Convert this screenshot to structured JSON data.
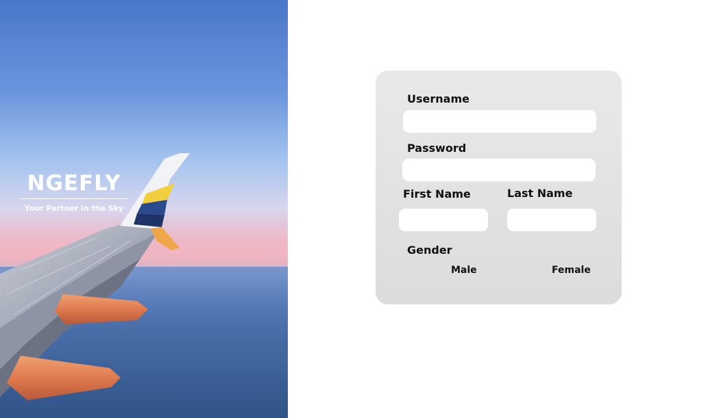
{
  "brand": {
    "name": "NGEFLY",
    "tagline": "Your Partner in the Sky"
  },
  "form": {
    "username": {
      "label": "Username",
      "value": "",
      "placeholder": ""
    },
    "password": {
      "label": "Password",
      "value": "",
      "placeholder": ""
    },
    "first_name": {
      "label": "First Name",
      "value": "",
      "placeholder": ""
    },
    "last_name": {
      "label": "Last Name",
      "value": "",
      "placeholder": ""
    },
    "gender": {
      "label": "Gender",
      "options": [
        "Male",
        "Female"
      ]
    }
  },
  "colors": {
    "card_background": "#dcdcdc",
    "field_background": "#ffffff",
    "label_text": "#111111",
    "brand_text": "#ffffff"
  }
}
